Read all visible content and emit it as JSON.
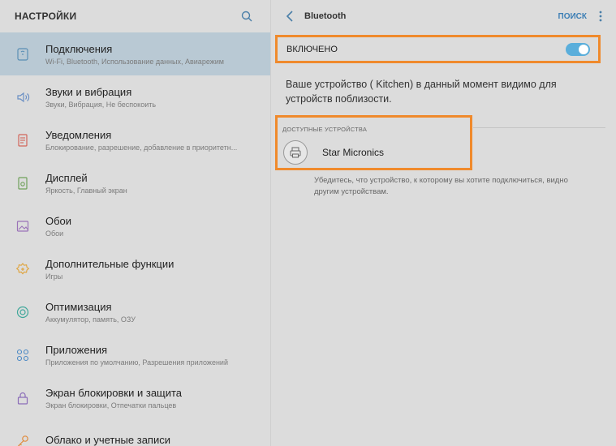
{
  "left": {
    "title": "НАСТРОЙКИ",
    "items": [
      {
        "icon": "connections-icon",
        "title": "Подключения",
        "sub": "Wi-Fi, Bluetooth, Использование данных, Авиарежим"
      },
      {
        "icon": "sound-icon",
        "title": "Звуки и вибрация",
        "sub": "Звуки, Вибрация, Не беспокоить"
      },
      {
        "icon": "notifications-icon",
        "title": "Уведомления",
        "sub": "Блокирование, разрешение, добавление в приоритетн..."
      },
      {
        "icon": "display-icon",
        "title": "Дисплей",
        "sub": "Яркость, Главный экран"
      },
      {
        "icon": "wallpaper-icon",
        "title": "Обои",
        "sub": "Обои"
      },
      {
        "icon": "advanced-features-icon",
        "title": "Дополнительные функции",
        "sub": "Игры"
      },
      {
        "icon": "optimization-icon",
        "title": "Оптимизация",
        "sub": "Аккумулятор, память, ОЗУ"
      },
      {
        "icon": "apps-icon",
        "title": "Приложения",
        "sub": "Приложения по умолчанию, Разрешения приложений"
      },
      {
        "icon": "lock-icon",
        "title": "Экран блокировки и защита",
        "sub": "Экран блокировки, Отпечатки пальцев"
      },
      {
        "icon": "cloud-key-icon",
        "title": "Облако и учетные записи",
        "sub": ""
      }
    ]
  },
  "right": {
    "title": "Bluetooth",
    "search_label": "ПОИСК",
    "switch_label": "ВКЛЮЧЕНО",
    "switch_on": true,
    "visibility_text": "Ваше устройство (      Kitchen) в данный момент видимо для устройств поблизости.",
    "section_label": "ДОСТУПНЫЕ УСТРОЙСТВА",
    "device_name": "Star Micronics",
    "hint_text": "Убедитесь, что устройство, к которому вы хотите подключиться, видно другим устройствам."
  },
  "colors": {
    "accent": "#3d7fb5",
    "toggle": "#5aaedb",
    "highlight_border": "#f08a2c",
    "active_item": "#b9c9d4"
  }
}
